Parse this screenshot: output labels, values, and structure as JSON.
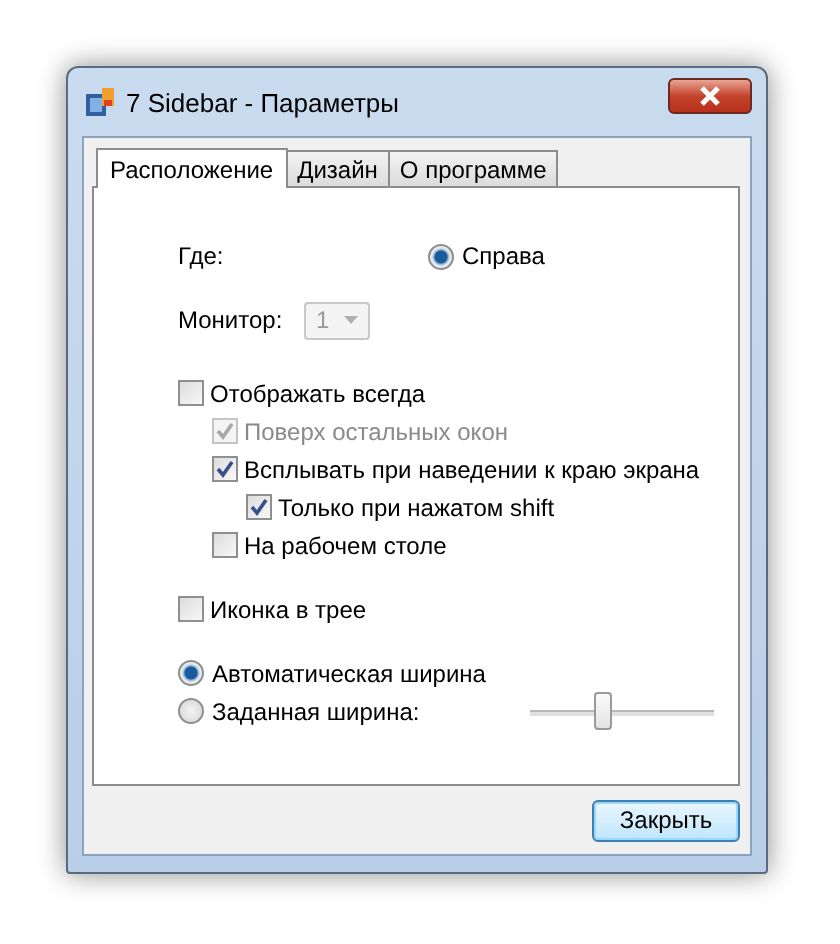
{
  "window": {
    "title": "7 Sidebar - Параметры"
  },
  "tabs": [
    {
      "label": "Расположение",
      "selected": true
    },
    {
      "label": "Дизайн",
      "selected": false
    },
    {
      "label": "О программе",
      "selected": false
    }
  ],
  "position": {
    "label": "Где:",
    "option": {
      "label": "Справа",
      "selected": true
    }
  },
  "monitor": {
    "label": "Монитор:",
    "value": "1",
    "disabled": true
  },
  "options": [
    {
      "label": "Отображать всегда",
      "checked": false,
      "disabled": false,
      "children": [
        {
          "label": "Поверх остальных окон",
          "checked": true,
          "disabled": true
        },
        {
          "label": "Всплывать при наведении к краю экрана",
          "checked": true,
          "disabled": false,
          "children": [
            {
              "label": "Только при нажатом shift",
              "checked": true,
              "disabled": false
            }
          ]
        },
        {
          "label": "На рабочем столе",
          "checked": false,
          "disabled": false
        }
      ]
    }
  ],
  "tray": {
    "label": "Иконка в трее",
    "checked": false,
    "disabled": false
  },
  "width_modes": [
    {
      "label": "Автоматическая ширина",
      "selected": true
    },
    {
      "label": "Заданная ширина:",
      "selected": false
    }
  ],
  "width_slider": {
    "level": 0.4
  },
  "close_button": {
    "label": "Закрыть"
  }
}
